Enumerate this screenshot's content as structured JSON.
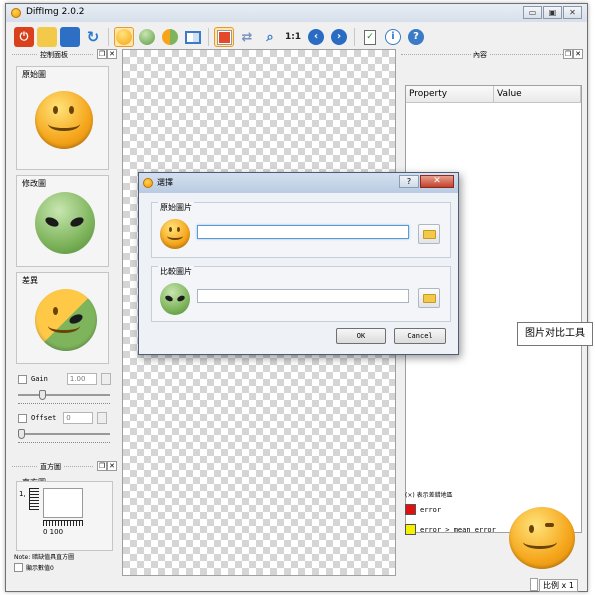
{
  "app": {
    "title": "DiffImg 2.0.2"
  },
  "window_controls": {
    "minimize": "▭",
    "maximize": "▣",
    "close": "✕"
  },
  "toolbar": {
    "icons": [
      "power-icon",
      "folder-icon",
      "save-icon",
      "refresh-icon",
      "original-image-icon",
      "modified-image-icon",
      "difference-image-icon",
      "split-view-icon",
      "mask-icon",
      "arrows-icon",
      "zoom-fit-icon",
      "one-to-one-icon",
      "previous-icon",
      "next-icon",
      "checklist-icon",
      "info-icon",
      "help-icon"
    ],
    "one_to_one_label": "1:1"
  },
  "left_panel": {
    "title": "控制面板",
    "original_label": "原始圖",
    "modified_label": "修改圖",
    "difference_label": "差異",
    "gain_label": "Gain",
    "gain_value": "1.00",
    "offset_label": "Offset",
    "offset_value": "0"
  },
  "histogram": {
    "title": "直方圖",
    "group_label": "直方圖",
    "y_tick": "1,",
    "x_tick": "0 100",
    "note": "Note: 暗缺值具直方圖",
    "show_values_label": "顯示數值0"
  },
  "right_panel": {
    "title": "內容",
    "columns": [
      "Property",
      "Value"
    ],
    "show_mask_label": "(×) 表示差錯地區",
    "legend": [
      {
        "label": "error",
        "color": "#e01010"
      },
      {
        "label": "error > mean error",
        "color": "#f5f000"
      }
    ]
  },
  "status": {
    "zoom": "比例 x 1"
  },
  "dialog": {
    "title": "選擇",
    "help": "?",
    "close": "✕",
    "original_group": "原始圖片",
    "compare_group": "比較圖片",
    "ok_label": "OK",
    "cancel_label": "Cancel"
  },
  "tooltip": "图片对比工具"
}
